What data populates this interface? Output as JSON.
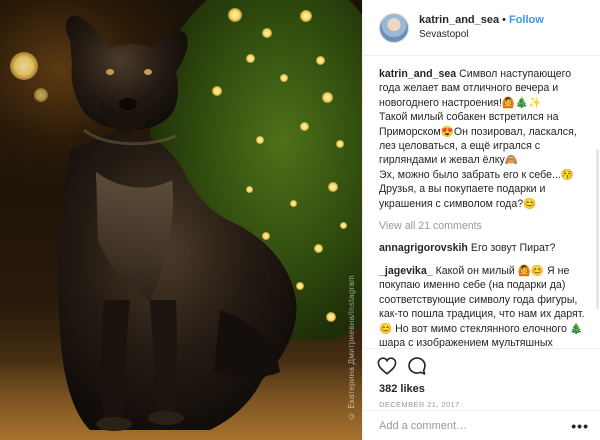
{
  "post": {
    "username": "katrin_and_sea",
    "separator": "•",
    "follow_label": "Follow",
    "location": "Sevastopol",
    "photo_watermark": "© Екатерина Дмитриевна/Instagram",
    "caption": {
      "user": "katrin_and_sea",
      "text": "Символ наступающего года желает вам отличного вечера и новогоднего настроения!🙆🎄✨\nТакой милый собакен встретился на Приморском😍Он позировал, ласкался, лез целоваться, а ещё игрался с гирляндами и жевал ёлку🙈\nЭх, можно было забрать его к себе...😚\nДрузья, а вы покупаете подарки и украшения с символом года?😊"
    },
    "view_all_label": "View all 21 comments",
    "comments": [
      {
        "user": "annagrigorovskih",
        "text": "Его зовут Пират?"
      },
      {
        "user": "_jagevika_",
        "text": "Какой он милый 🙆😊 Я не покупаю именно себе (на подарки да) соответствующие символу года фигуры, как-то пошла традиция, что нам их дарят. 😊 Но вот мимо стеклянного елочного 🎄шара с изображением мультяшных Бобика и Барбоса не смогла пройти"
      }
    ],
    "likes": "382 likes",
    "date": "DECEMBER 21, 2017",
    "add_comment_placeholder": "Add a comment…",
    "more_label": "•••"
  },
  "colors": {
    "follow": "#3897f0",
    "muted": "#999999",
    "text": "#262626",
    "border": "#efefef"
  },
  "icons": {
    "like": "heart-icon",
    "comment": "speech-bubble-icon",
    "more": "more-options-icon"
  }
}
